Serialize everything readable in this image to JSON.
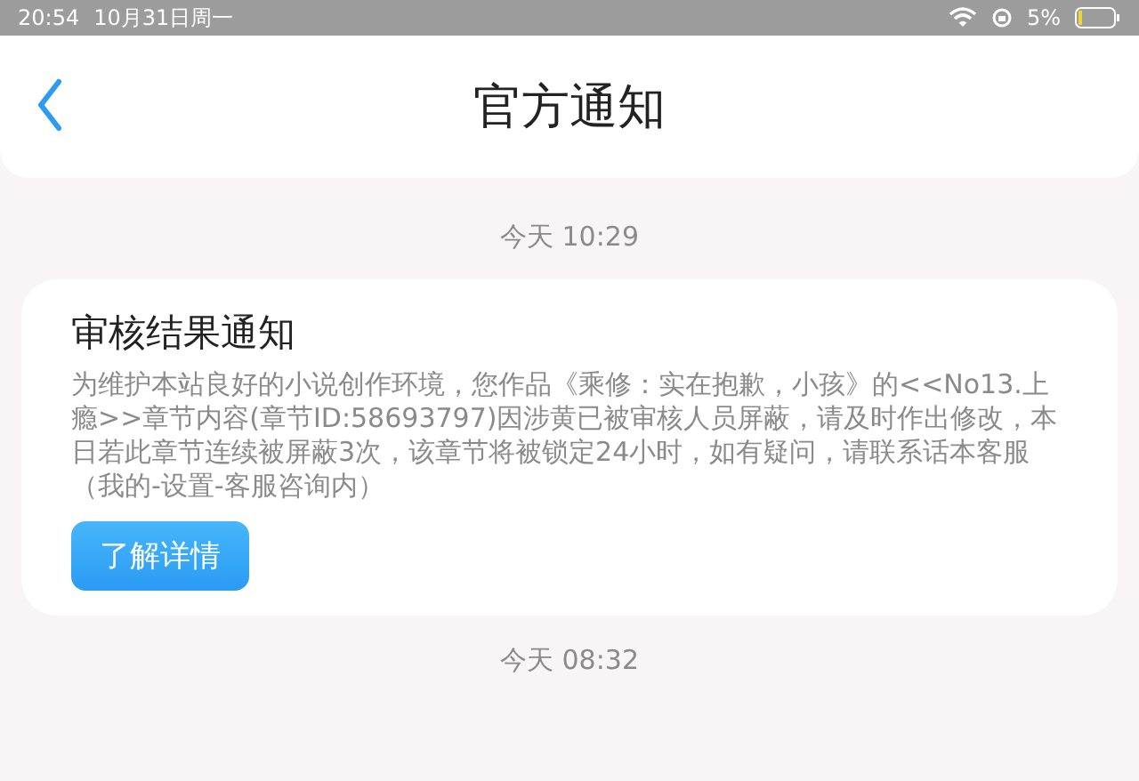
{
  "status_bar": {
    "time": "20:54",
    "date": "10月31日周一",
    "battery": "5%"
  },
  "header": {
    "title": "官方通知"
  },
  "messages": [
    {
      "time": "今天 10:29",
      "title": "审核结果通知",
      "body": "为维护本站良好的小说创作环境，您作品《乘修：实在抱歉，小孩》的<<No13.上瘾>>章节内容(章节ID:58693797)因涉黄已被审核人员屏蔽，请及时作出修改，本日若此章节连续被屏蔽3次，该章节将被锁定24小时，如有疑问，请联系话本客服（我的-设置-客服咨询内）",
      "button": "了解详情"
    }
  ],
  "next_time": "今天 08:32"
}
